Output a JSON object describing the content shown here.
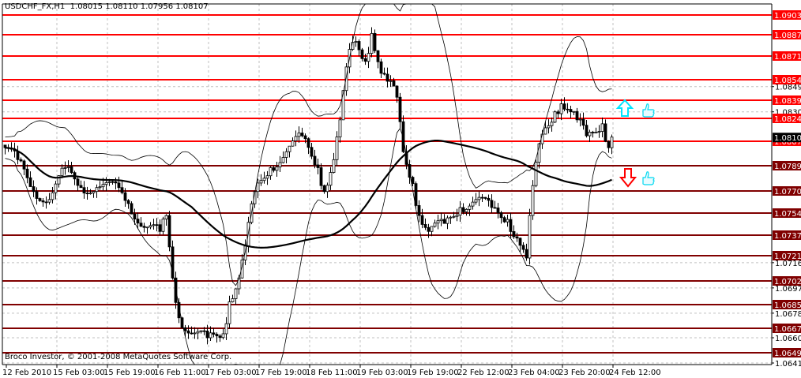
{
  "header": {
    "symbol": "USDCHF_FX,H1",
    "ohlc": "1.08015 1.08110 1.07956 1.08107"
  },
  "footer": {
    "copyright": "Broco Investor, © 2001-2008 MetaQuotes Software Corp."
  },
  "colors": {
    "resistance": "#ff0000",
    "support": "#800000",
    "signal_up": "#00e5ff",
    "signal_down": "#ff0000",
    "thumb": "#00e5ff",
    "grid": "#c0c0c0"
  },
  "chart_data": {
    "type": "candlestick",
    "symbol": "USDCHF_FX",
    "timeframe": "H1",
    "ylim": [
      1.0636,
      1.091
    ],
    "current_price": "1.08107",
    "price_ticks": [
      "1.08490",
      "1.08300",
      "1.07165",
      "1.06975",
      "1.06785",
      "1.06600",
      "1.06410"
    ],
    "time_labels": [
      "12 Feb 2010",
      "15 Feb 03:00",
      "15 Feb 19:00",
      "16 Feb 11:00",
      "17 Feb 03:00",
      "17 Feb 19:00",
      "18 Feb 11:00",
      "19 Feb 03:00",
      "19 Feb 19:00",
      "22 Feb 12:00",
      "23 Feb 04:00",
      "23 Feb 20:00",
      "24 Feb 12:00"
    ],
    "bars_between_labels": 16,
    "level_lines": [
      {
        "price": "1.09031",
        "type": "resistance"
      },
      {
        "price": "1.08878",
        "type": "resistance"
      },
      {
        "price": "1.08718",
        "type": "resistance"
      },
      {
        "price": "1.08543",
        "type": "resistance"
      },
      {
        "price": "1.08390",
        "type": "resistance"
      },
      {
        "price": "1.08248",
        "type": "resistance"
      },
      {
        "price": "1.08077",
        "type": "resistance"
      },
      {
        "price": "1.07895",
        "type": "support"
      },
      {
        "price": "1.07707",
        "type": "support"
      },
      {
        "price": "1.07541",
        "type": "support"
      },
      {
        "price": "1.07370",
        "type": "support"
      },
      {
        "price": "1.07216",
        "type": "support"
      },
      {
        "price": "1.07028",
        "type": "support"
      },
      {
        "price": "1.06851",
        "type": "support"
      },
      {
        "price": "1.06674",
        "type": "support"
      },
      {
        "price": "1.06490",
        "type": "support"
      }
    ],
    "close_keypoints": [
      [
        0,
        1.0803
      ],
      [
        4,
        1.0794
      ],
      [
        9,
        1.077
      ],
      [
        14,
        1.0764
      ],
      [
        19,
        1.0788
      ],
      [
        24,
        1.0773
      ],
      [
        29,
        1.0773
      ],
      [
        36,
        1.0773
      ],
      [
        39,
        1.0761
      ],
      [
        44,
        1.0743
      ],
      [
        49,
        1.074
      ],
      [
        51,
        1.0752
      ],
      [
        53,
        1.0705
      ],
      [
        55,
        1.0675
      ],
      [
        59,
        1.0663
      ],
      [
        64,
        1.066
      ],
      [
        69,
        1.0663
      ],
      [
        71,
        1.0687
      ],
      [
        74,
        1.0705
      ],
      [
        76,
        1.0729
      ],
      [
        79,
        1.077
      ],
      [
        84,
        1.0788
      ],
      [
        89,
        1.08
      ],
      [
        94,
        1.0812
      ],
      [
        99,
        1.0788
      ],
      [
        101,
        1.077
      ],
      [
        104,
        1.0794
      ],
      [
        106,
        1.0824
      ],
      [
        109,
        1.0877
      ],
      [
        111,
        1.0883
      ],
      [
        114,
        1.0868
      ],
      [
        116,
        1.0889
      ],
      [
        119,
        1.0859
      ],
      [
        121,
        1.0853
      ],
      [
        124,
        1.0841
      ],
      [
        126,
        1.08
      ],
      [
        129,
        1.0776
      ],
      [
        131,
        1.0752
      ],
      [
        134,
        1.074
      ],
      [
        139,
        1.0746
      ],
      [
        144,
        1.0758
      ],
      [
        149,
        1.0764
      ],
      [
        154,
        1.0758
      ],
      [
        159,
        1.0749
      ],
      [
        162,
        1.0735
      ],
      [
        165,
        1.072
      ],
      [
        166,
        1.0752
      ],
      [
        169,
        1.0806
      ],
      [
        171,
        1.0818
      ],
      [
        174,
        1.083
      ],
      [
        176,
        1.0836
      ],
      [
        179,
        1.083
      ],
      [
        181,
        1.0824
      ],
      [
        184,
        1.0812
      ],
      [
        189,
        1.0821
      ],
      [
        191,
        1.0803
      ],
      [
        192,
        1.0811
      ]
    ],
    "indicators": [
      {
        "name": "Moving Average",
        "style": "thick"
      },
      {
        "name": "Bollinger Bands",
        "style": "thin"
      }
    ],
    "signals": [
      {
        "type": "up-arrow",
        "near_price": "1.08300"
      },
      {
        "type": "down-arrow",
        "near_price": "1.07800"
      }
    ]
  }
}
